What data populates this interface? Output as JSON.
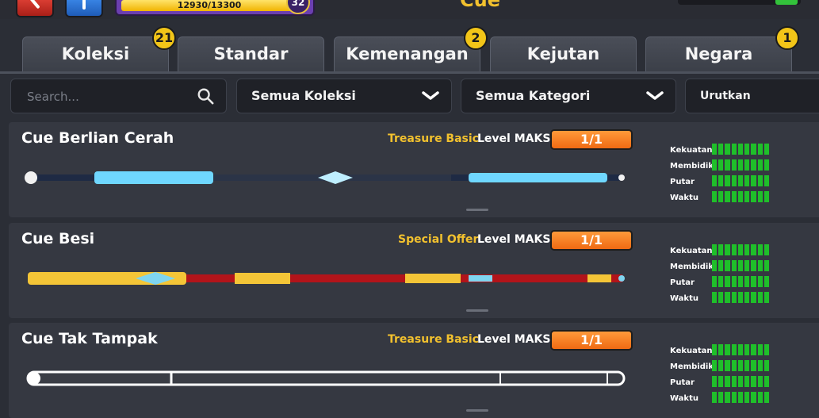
{
  "header": {
    "title": "Cue",
    "xp_text": "12930/13300",
    "xp_progress": 0.972,
    "level": "32"
  },
  "tabs": [
    {
      "label": "Koleksi",
      "badge": "21"
    },
    {
      "label": "Standar",
      "badge": ""
    },
    {
      "label": "Kemenangan",
      "badge": "2"
    },
    {
      "label": "Kejutan",
      "badge": ""
    },
    {
      "label": "Negara",
      "badge": "1"
    }
  ],
  "filters": {
    "search_placeholder": "Search...",
    "collection_select": "Semua Koleksi",
    "category_select": "Semua Kategori",
    "sort_label": "Urutkan berdasarkan:"
  },
  "stat_labels": [
    "Kekuatan",
    "Membidik",
    "Putar",
    "Waktu"
  ],
  "cues": [
    {
      "name": "Cue Berlian Cerah",
      "tag": "Treasure Basic",
      "level": "Level MAKS",
      "count": "1/1",
      "stats": [
        1,
        1,
        1,
        1
      ],
      "colors": {
        "main": "#1e2a44",
        "accent": "#6fd7ff",
        "tip": "#f1f1f1"
      }
    },
    {
      "name": "Cue Besi",
      "tag": "Special Offer",
      "level": "Level MAKS",
      "count": "1/1",
      "stats": [
        1,
        1,
        1,
        1
      ],
      "colors": {
        "main": "#b2141a",
        "accent": "#f4c537",
        "tip": "#7fd5f0"
      }
    },
    {
      "name": "Cue Tak Tampak",
      "tag": "Treasure Basic",
      "level": "Level MAKS",
      "count": "1/1",
      "stats": [
        1,
        1,
        1,
        1
      ],
      "colors": {
        "main": "#3a3d45",
        "accent": "#ffffff",
        "tip": "#ffffff"
      }
    }
  ],
  "colors": {
    "badge": "#f2c518",
    "count_button": "#ef6a13",
    "tag_text": "#f2c12e",
    "stat_bar": "#1fbf2a"
  }
}
